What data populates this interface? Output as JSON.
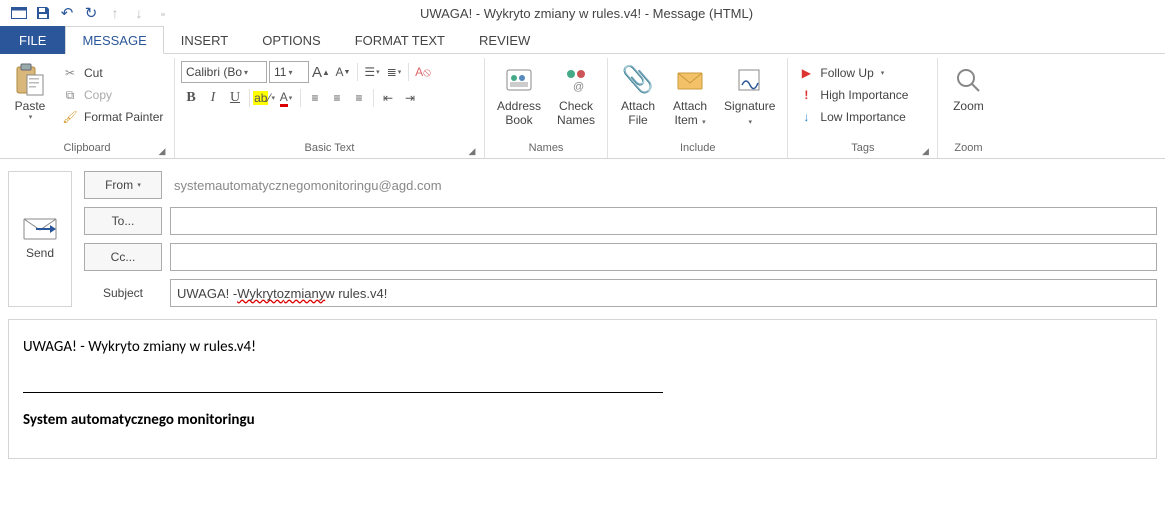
{
  "window_title": "UWAGA! - Wykryto zmiany w rules.v4! - Message (HTML)",
  "tabs": {
    "file": "FILE",
    "message": "MESSAGE",
    "insert": "INSERT",
    "options": "OPTIONS",
    "format_text": "FORMAT TEXT",
    "review": "REVIEW"
  },
  "ribbon": {
    "clipboard": {
      "label": "Clipboard",
      "paste": "Paste",
      "cut": "Cut",
      "copy": "Copy",
      "format_painter": "Format Painter"
    },
    "basic_text": {
      "label": "Basic Text",
      "font_name": "Calibri (Bo",
      "font_size": "11"
    },
    "names": {
      "label": "Names",
      "address_book": "Address\nBook",
      "check_names": "Check\nNames"
    },
    "include": {
      "label": "Include",
      "attach_file": "Attach\nFile",
      "attach_item": "Attach\nItem",
      "signature": "Signature"
    },
    "tags": {
      "label": "Tags",
      "follow_up": "Follow Up",
      "high_importance": "High Importance",
      "low_importance": "Low Importance"
    },
    "zoom": {
      "label": "Zoom",
      "zoom": "Zoom"
    }
  },
  "header": {
    "send": "Send",
    "from_label": "From",
    "from_value": "systemautomatycznegomonitoringu@agd.com",
    "to_label": "To...",
    "to_value": "",
    "cc_label": "Cc...",
    "cc_value": "",
    "subject_label": "Subject",
    "subject_value_pre": "UWAGA! - ",
    "subject_value_sq1": "Wykryto",
    "subject_value_mid": " ",
    "subject_value_sq2": "zmiany",
    "subject_value_post": " w rules.v4!"
  },
  "body": {
    "line1": "UWAGA! - Wykryto zmiany w rules.v4!",
    "signature": "System automatycznego monitoringu"
  }
}
